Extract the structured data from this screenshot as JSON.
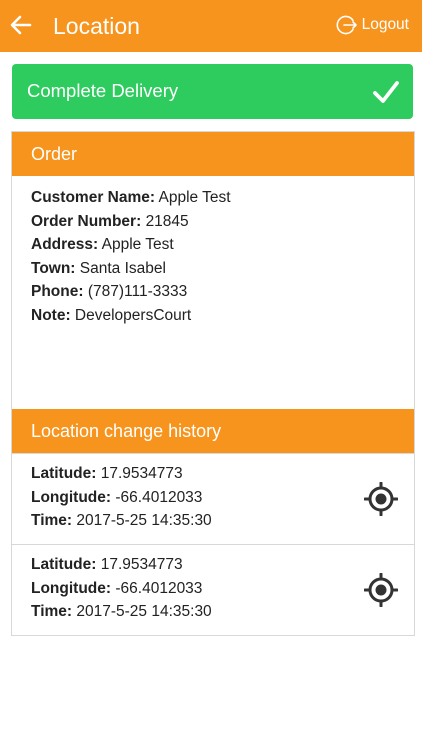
{
  "header": {
    "title": "Location",
    "logout_label": "Logout"
  },
  "complete_button": {
    "label": "Complete Delivery"
  },
  "order": {
    "section_title": "Order",
    "fields": [
      {
        "label": "Customer Name:",
        "value": "Apple Test"
      },
      {
        "label": "Order Number:",
        "value": "21845"
      },
      {
        "label": "Address:",
        "value": "Apple Test"
      },
      {
        "label": "Town:",
        "value": "Santa Isabel"
      },
      {
        "label": "Phone:",
        "value": "(787)111-3333"
      },
      {
        "label": "Note:",
        "value": "DevelopersCourt"
      }
    ]
  },
  "history": {
    "section_title": "Location change history",
    "entries": [
      {
        "latitude_label": "Latitude:",
        "latitude": "17.9534773",
        "longitude_label": "Longitude:",
        "longitude": "-66.4012033",
        "time_label": "Time:",
        "time": "2017-5-25 14:35:30"
      },
      {
        "latitude_label": "Latitude:",
        "latitude": "17.9534773",
        "longitude_label": "Longitude:",
        "longitude": "-66.4012033",
        "time_label": "Time:",
        "time": "2017-5-25 14:35:30"
      }
    ]
  },
  "colors": {
    "accent": "#f7941d",
    "success": "#2ecc5f"
  },
  "icons": {
    "back": "arrow-left-icon",
    "logout": "logout-icon",
    "complete": "checkmark-icon",
    "locate": "target-icon"
  }
}
